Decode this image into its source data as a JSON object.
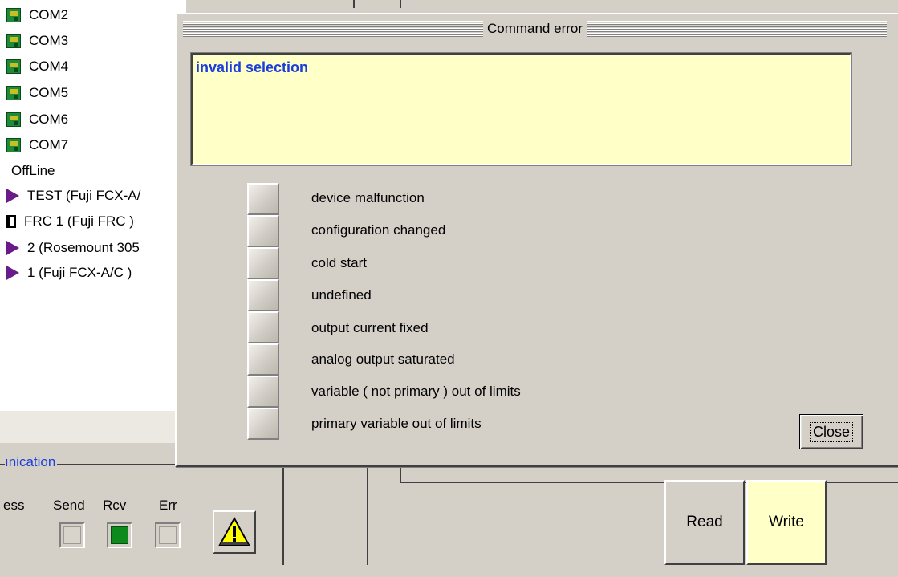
{
  "tree": {
    "ports": [
      "COM2",
      "COM3",
      "COM4",
      "COM5",
      "COM6",
      "COM7"
    ],
    "group_label": "OffLine",
    "devices": [
      "TEST (Fuji FCX-A/",
      "FRC 1 (Fuji FRC )",
      "2 (Rosemount 305",
      "1 (Fuji FCX-A/C )"
    ]
  },
  "communication": {
    "legend": "ınication",
    "col_cut": "ess",
    "send_label": "Send",
    "rcv_label": "Rcv",
    "err_label": "Err",
    "warn_icon": "warning-triangle-icon",
    "leds": {
      "send": "off",
      "rcv": "on",
      "err": "off"
    }
  },
  "actions": {
    "read_label": "Read",
    "write_label": "Write"
  },
  "dialog": {
    "title": "Command error",
    "message": "invalid selection",
    "flags": [
      "device malfunction",
      "configuration changed",
      "cold start",
      "undefined",
      "output current fixed",
      "analog output saturated",
      "variable ( not primary ) out of limits",
      "primary variable out of limits"
    ],
    "close_label": "Close"
  },
  "colors": {
    "message_text": "#1a3ddc",
    "message_bg": "#ffffc8",
    "write_bg": "#ffffc8",
    "led_on": "#0c8a1c"
  }
}
